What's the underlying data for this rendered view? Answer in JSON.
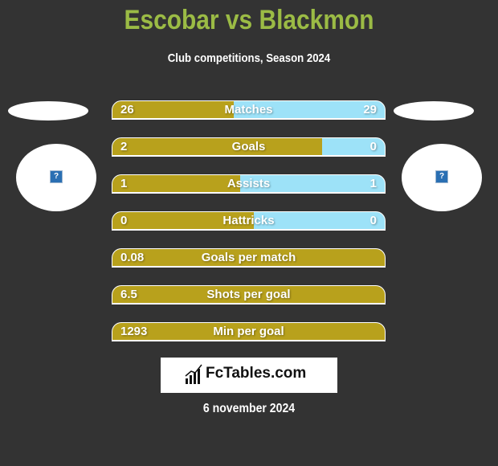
{
  "header": {
    "title": "Escobar vs Blackmon",
    "subtitle": "Club competitions, Season 2024"
  },
  "players": {
    "left": {
      "avatar_icon": "missing-image-icon"
    },
    "right": {
      "avatar_icon": "missing-image-icon"
    }
  },
  "colors": {
    "left": "#b8a11c",
    "right": "#9de2f8",
    "title": "#9bbb45",
    "background": "#333333"
  },
  "stats": [
    {
      "label": "Matches",
      "left": "26",
      "right": "29",
      "left_share": 0.446
    },
    {
      "label": "Goals",
      "left": "2",
      "right": "0",
      "left_share": 0.77
    },
    {
      "label": "Assists",
      "left": "1",
      "right": "1",
      "left_share": 0.47
    },
    {
      "label": "Hattricks",
      "left": "0",
      "right": "0",
      "left_share": 0.52
    },
    {
      "label": "Goals per match",
      "left": "0.08",
      "right": ""
    },
    {
      "label": "Shots per goal",
      "left": "6.5",
      "right": ""
    },
    {
      "label": "Min per goal",
      "left": "1293",
      "right": ""
    }
  ],
  "footer": {
    "logo_text": "FcTables.com",
    "date": "6 november 2024"
  }
}
